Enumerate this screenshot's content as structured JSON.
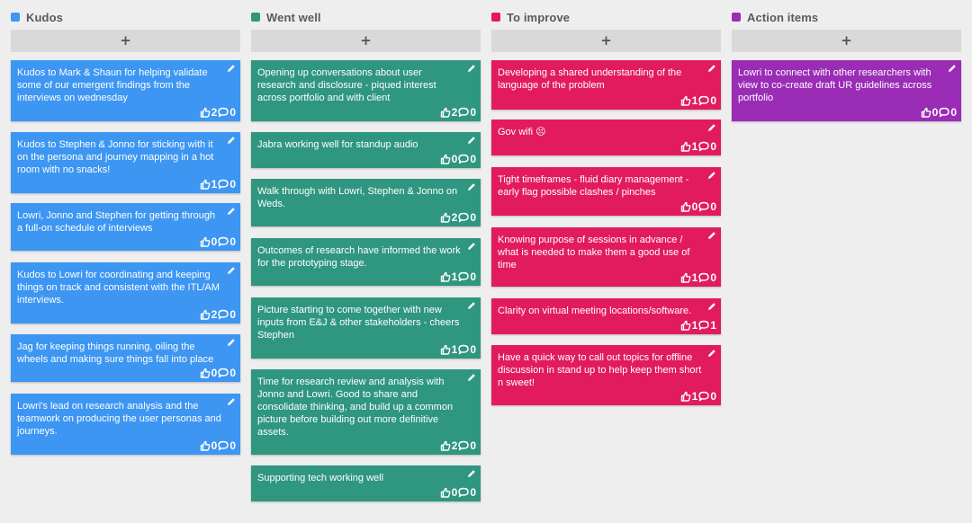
{
  "colors": {
    "kudos": "#3d96f2",
    "went_well": "#2f9680",
    "to_improve": "#e21b5e",
    "action_items": "#9a2cb6",
    "background": "#eeeeee",
    "add_button": "#d9d9d9"
  },
  "icons": {
    "add": "plus-icon",
    "edit": "pencil-icon",
    "vote": "thumbs-up-icon",
    "comment": "speech-bubble-icon"
  },
  "add_label": "+",
  "columns": [
    {
      "title": "Kudos",
      "cards": [
        {
          "text": "Kudos to Mark & Shaun for helping validate some of our emergent findings from the interviews on wednesday",
          "votes": "2",
          "comments": "0"
        },
        {
          "text": "Kudos to Stephen & Jonno for sticking with it on the persona and journey mapping in a hot room with no snacks!",
          "votes": "1",
          "comments": "0"
        },
        {
          "text": "Lowri, Jonno and Stephen for getting through a full-on schedule of interviews",
          "votes": "0",
          "comments": "0"
        },
        {
          "text": "Kudos to Lowri for coordinating and keeping things on track and consistent with the ITL/AM interviews.",
          "votes": "2",
          "comments": "0"
        },
        {
          "text": "Jag for keeping things running, oiling the wheels and making sure things fall into place",
          "votes": "0",
          "comments": "0"
        },
        {
          "text": "Lowri's lead on research analysis and the teamwork on producing the user personas and journeys.",
          "votes": "0",
          "comments": "0"
        }
      ]
    },
    {
      "title": "Went well",
      "cards": [
        {
          "text": "Opening up conversations about user research and disclosure - piqued interest across portfolio and with client",
          "votes": "2",
          "comments": "0"
        },
        {
          "text": "Jabra working well for standup audio",
          "votes": "0",
          "comments": "0"
        },
        {
          "text": "Walk through with Lowri, Stephen & Jonno on Weds.",
          "votes": "2",
          "comments": "0"
        },
        {
          "text": "Outcomes of research have informed the work for the prototyping stage.",
          "votes": "1",
          "comments": "0"
        },
        {
          "text": "Picture starting to come together with new inputs from E&J & other stakeholders - cheers Stephen",
          "votes": "1",
          "comments": "0"
        },
        {
          "text": "Time for research review and analysis with Jonno and Lowri. Good to share and consolidate thinking, and build up a common picture before building out more definitive assets.",
          "votes": "2",
          "comments": "0"
        },
        {
          "text": "Supporting tech working well",
          "votes": "0",
          "comments": "0"
        }
      ]
    },
    {
      "title": "To improve",
      "cards": [
        {
          "text": "Developing a shared understanding of the language of the problem",
          "votes": "1",
          "comments": "0"
        },
        {
          "text": "Gov wifi 😣",
          "votes": "1",
          "comments": "0"
        },
        {
          "text": "Tight timeframes - fluid diary management - early flag possible clashes / pinches",
          "votes": "0",
          "comments": "0"
        },
        {
          "text": "Knowing purpose of sessions in advance / what is needed to make them a good use of time",
          "votes": "1",
          "comments": "0"
        },
        {
          "text": "Clarity on virtual meeting locations/software.",
          "votes": "1",
          "comments": "1"
        },
        {
          "text": "Have a quick way to call out topics for offline discussion in stand up to help keep them short n sweet!",
          "votes": "1",
          "comments": "0"
        }
      ]
    },
    {
      "title": "Action items",
      "cards": [
        {
          "text": "Lowri to connect with other researchers with view to co-create draft UR guidelines across portfolio",
          "votes": "0",
          "comments": "0"
        }
      ]
    }
  ]
}
